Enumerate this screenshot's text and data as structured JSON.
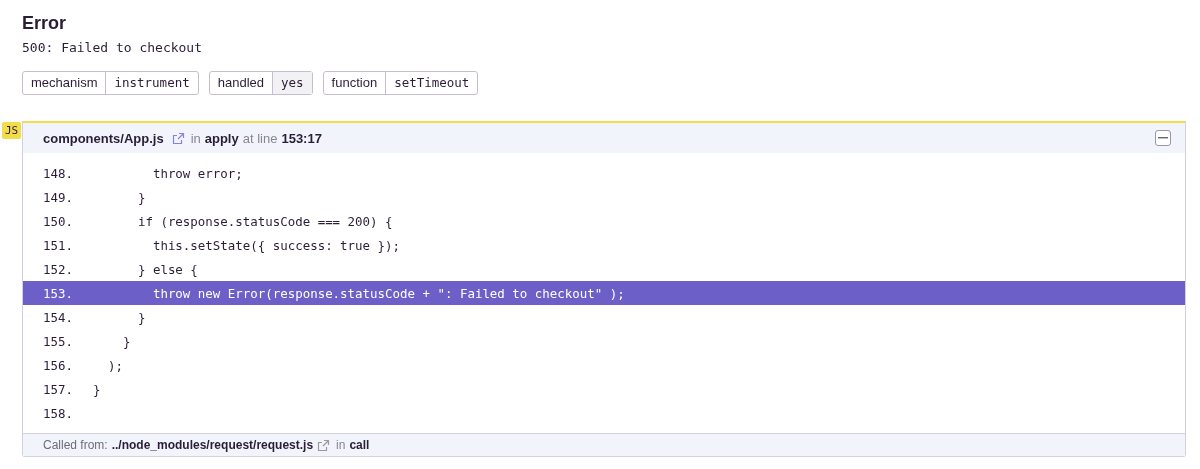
{
  "title": "Error",
  "message": "500: Failed to checkout",
  "tags": [
    {
      "key": "mechanism",
      "value": "instrument",
      "highlighted": false
    },
    {
      "key": "handled",
      "value": "yes",
      "highlighted": true
    },
    {
      "key": "function",
      "value": "setTimeout",
      "highlighted": false
    }
  ],
  "frame": {
    "platform": "JS",
    "filename": "components/App.js",
    "in_label": "in",
    "function": "apply",
    "at_label": "at line",
    "location": "153:17",
    "lines": [
      {
        "number": "148.",
        "code": "        throw error;",
        "highlighted": false
      },
      {
        "number": "149.",
        "code": "      }",
        "highlighted": false
      },
      {
        "number": "150.",
        "code": "      if (response.statusCode === 200) {",
        "highlighted": false
      },
      {
        "number": "151.",
        "code": "        this.setState({ success: true });",
        "highlighted": false
      },
      {
        "number": "152.",
        "code": "      } else {",
        "highlighted": false
      },
      {
        "number": "153.",
        "code": "        throw new Error(response.statusCode + \": Failed to checkout\" );",
        "highlighted": true
      },
      {
        "number": "154.",
        "code": "      }",
        "highlighted": false
      },
      {
        "number": "155.",
        "code": "    }",
        "highlighted": false
      },
      {
        "number": "156.",
        "code": "  );",
        "highlighted": false
      },
      {
        "number": "157.",
        "code": "}",
        "highlighted": false
      },
      {
        "number": "158.",
        "highlighted": false
      }
    ],
    "called_from": {
      "label": "Called from:",
      "filename": "../node_modules/request/request.js",
      "in_label": "in",
      "function": "call"
    }
  }
}
